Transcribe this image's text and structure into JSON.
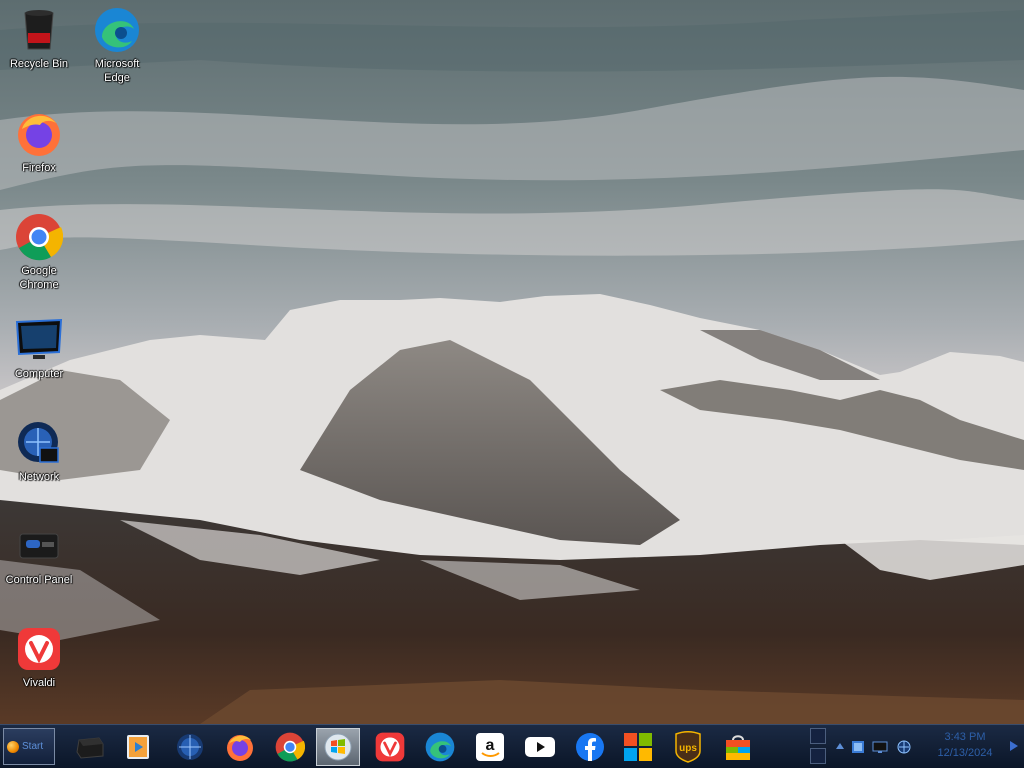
{
  "desktop": {
    "icons": [
      {
        "label": "Recycle Bin"
      },
      {
        "label": "Microsoft\nEdge"
      },
      {
        "label": "Firefox"
      },
      {
        "label": "Google\nChrome"
      },
      {
        "label": "Computer"
      },
      {
        "label": "Network"
      },
      {
        "label": "Control Panel"
      },
      {
        "label": "Vivaldi"
      }
    ]
  },
  "taskbar": {
    "start_label": "Start",
    "pinned": [
      {
        "name": "storage-drive-icon"
      },
      {
        "name": "media-player-icon"
      },
      {
        "name": "network-globe-icon"
      },
      {
        "name": "firefox-icon"
      },
      {
        "name": "chrome-icon"
      },
      {
        "name": "windows-flag-icon",
        "active": true
      },
      {
        "name": "vivaldi-icon"
      },
      {
        "name": "edge-icon"
      },
      {
        "name": "amazon-icon"
      },
      {
        "name": "youtube-icon"
      },
      {
        "name": "facebook-icon"
      },
      {
        "name": "microsoft-icon"
      },
      {
        "name": "ups-icon"
      },
      {
        "name": "store-bag-icon"
      }
    ],
    "tray": {
      "icons": [
        "up-arrow-icon",
        "sticky-note-icon",
        "monitor-icon",
        "network-icon"
      ],
      "time": "3:43 PM",
      "date": "12/13/2024"
    }
  },
  "colors": {
    "taskbar_bg": "#0f1b30",
    "clock_text": "#2d5fa8",
    "sky": "#7b898b",
    "snow": "#e6e4e2"
  }
}
